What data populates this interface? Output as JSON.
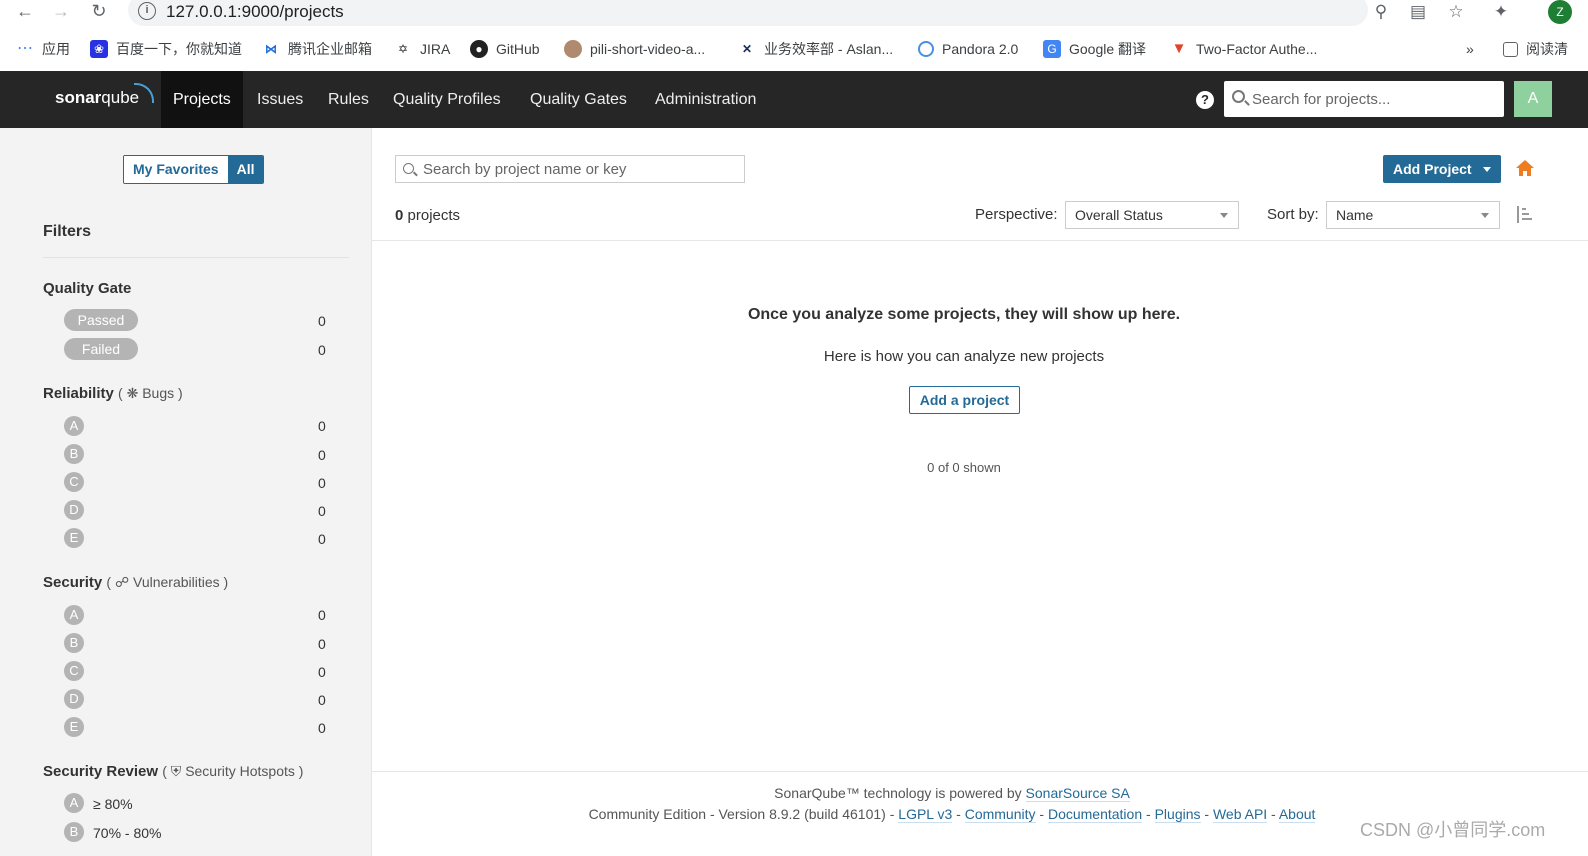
{
  "browser": {
    "url": "127.0.0.1:9000/projects",
    "profile_initial": "Z",
    "bookmarks": [
      {
        "label": "应用",
        "icon": "apps-grid-icon"
      },
      {
        "label": "百度一下，你就知道",
        "icon": "baidu-paw-icon"
      },
      {
        "label": "腾讯企业邮箱",
        "icon": "tencent-mail-icon"
      },
      {
        "label": "JIRA",
        "icon": "jira-icon"
      },
      {
        "label": "GitHub",
        "icon": "github-icon"
      },
      {
        "label": "pili-short-video-a...",
        "icon": "avatar-icon"
      },
      {
        "label": "业务效率部 - Aslan...",
        "icon": "aslan-icon"
      },
      {
        "label": "Pandora 2.0",
        "icon": "pandora-icon"
      },
      {
        "label": "Google 翻译",
        "icon": "google-translate-icon"
      },
      {
        "label": "Two-Factor Authe...",
        "icon": "gitlab-icon"
      }
    ],
    "overflow": "»",
    "reading_list": "阅读清"
  },
  "navbar": {
    "logo_prefix": "sonar",
    "logo_suffix": "qube",
    "items": [
      "Projects",
      "Issues",
      "Rules",
      "Quality Profiles",
      "Quality Gates",
      "Administration"
    ],
    "active": "Projects",
    "help": "?",
    "search_placeholder": "Search for projects...",
    "avatar": "A"
  },
  "sidebar": {
    "favorites_label": "My Favorites",
    "all_label": "All",
    "filters_title": "Filters",
    "quality_gate": {
      "title": "Quality Gate",
      "options": [
        {
          "label": "Passed",
          "count": "0"
        },
        {
          "label": "Failed",
          "count": "0"
        }
      ]
    },
    "reliability": {
      "title": "Reliability",
      "sub": "Bugs",
      "ratings": [
        {
          "grade": "A",
          "count": "0"
        },
        {
          "grade": "B",
          "count": "0"
        },
        {
          "grade": "C",
          "count": "0"
        },
        {
          "grade": "D",
          "count": "0"
        },
        {
          "grade": "E",
          "count": "0"
        }
      ]
    },
    "security": {
      "title": "Security",
      "sub": "Vulnerabilities",
      "ratings": [
        {
          "grade": "A",
          "count": "0"
        },
        {
          "grade": "B",
          "count": "0"
        },
        {
          "grade": "C",
          "count": "0"
        },
        {
          "grade": "D",
          "count": "0"
        },
        {
          "grade": "E",
          "count": "0"
        }
      ]
    },
    "security_review": {
      "title": "Security Review",
      "sub": "Security Hotspots",
      "ratings": [
        {
          "grade": "A",
          "label": "≥ 80%"
        },
        {
          "grade": "B",
          "label": "70% - 80%"
        }
      ]
    }
  },
  "main": {
    "search_placeholder": "Search by project name or key",
    "add_project_label": "Add Project",
    "project_count": "0",
    "project_count_suffix": "projects",
    "perspective_label": "Perspective:",
    "perspective_value": "Overall Status",
    "sort_label": "Sort by:",
    "sort_value": "Name",
    "empty_title": "Once you analyze some projects, they will show up here.",
    "empty_sub": "Here is how you can analyze new projects",
    "add_a_project_label": "Add a project",
    "shown": "0 of 0 shown"
  },
  "footer": {
    "line1_prefix": "SonarQube™ technology is powered by ",
    "line1_link": "SonarSource SA",
    "line2_prefix": "Community Edition - Version 8.9.2 (build 46101) - ",
    "links": [
      "LGPL v3",
      "Community",
      "Documentation",
      "Plugins",
      "Web API",
      "About"
    ]
  },
  "watermark": "CSDN @小曾同学.com",
  "colors": {
    "brand_blue": "#236a97",
    "nav_bg": "#262626",
    "avatar_green": "#8fd19e",
    "home_orange": "#ed7d20"
  }
}
